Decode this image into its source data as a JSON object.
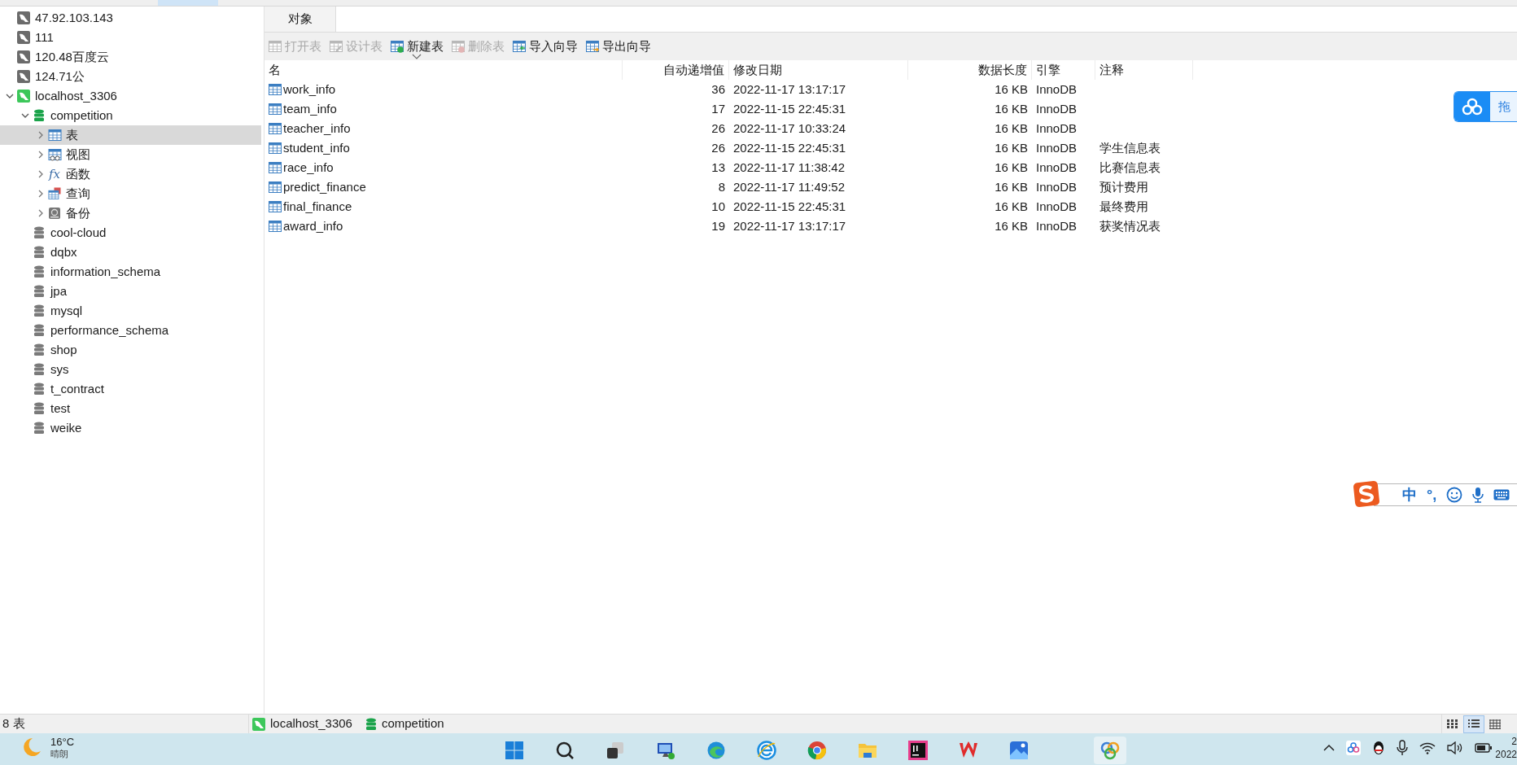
{
  "sidebar": {
    "tree": [
      {
        "kind": "connection",
        "name": "47.92.103.143",
        "connected": false,
        "selected": false
      },
      {
        "kind": "connection",
        "name": "111",
        "connected": false,
        "selected": false
      },
      {
        "kind": "connection",
        "name": "120.48百度云",
        "connected": false,
        "selected": false
      },
      {
        "kind": "connection",
        "name": "124.71公",
        "connected": false,
        "selected": false
      },
      {
        "kind": "connection",
        "name": "localhost_3306",
        "connected": true,
        "expanded": true,
        "selected": false,
        "children": [
          {
            "kind": "database",
            "name": "competition",
            "open": true,
            "expanded": true,
            "selected": false,
            "children": [
              {
                "kind": "tables",
                "name": "表",
                "expanded": false,
                "selected": true
              },
              {
                "kind": "views",
                "name": "视图",
                "expanded": false,
                "selected": false
              },
              {
                "kind": "functions",
                "icon": "fx",
                "name": "函数",
                "expanded": false,
                "selected": false
              },
              {
                "kind": "queries",
                "name": "查询",
                "expanded": false,
                "selected": false
              },
              {
                "kind": "backups",
                "name": "备份",
                "expanded": false,
                "selected": false
              }
            ]
          },
          {
            "kind": "database",
            "name": "cool-cloud",
            "open": false,
            "selected": false
          },
          {
            "kind": "database",
            "name": "dqbx",
            "open": false,
            "selected": false
          },
          {
            "kind": "database",
            "name": "information_schema",
            "open": false,
            "selected": false
          },
          {
            "kind": "database",
            "name": "jpa",
            "open": false,
            "selected": false
          },
          {
            "kind": "database",
            "name": "mysql",
            "open": false,
            "selected": false
          },
          {
            "kind": "database",
            "name": "performance_schema",
            "open": false,
            "selected": false
          },
          {
            "kind": "database",
            "name": "shop",
            "open": false,
            "selected": false
          },
          {
            "kind": "database",
            "name": "sys",
            "open": false,
            "selected": false
          },
          {
            "kind": "database",
            "name": "t_contract",
            "open": false,
            "selected": false
          },
          {
            "kind": "database",
            "name": "test",
            "open": false,
            "selected": false
          },
          {
            "kind": "database",
            "name": "weike",
            "open": false,
            "selected": false
          }
        ]
      }
    ]
  },
  "tabs": [
    {
      "label": "对象",
      "selected": true
    }
  ],
  "toolbar": [
    {
      "kind": "open",
      "label": "打开表",
      "disabled": true
    },
    {
      "kind": "design",
      "label": "设计表",
      "disabled": true
    },
    {
      "kind": "new",
      "label": "新建表",
      "disabled": false
    },
    {
      "kind": "delete",
      "label": "删除表",
      "disabled": true
    },
    {
      "kind": "import",
      "label": "导入向导",
      "disabled": false
    },
    {
      "kind": "export",
      "label": "导出向导",
      "disabled": false
    }
  ],
  "table": {
    "columns": [
      {
        "label": "名"
      },
      {
        "label": "自动递增值"
      },
      {
        "label": "修改日期"
      },
      {
        "label": "数据长度"
      },
      {
        "label": "引擎"
      },
      {
        "label": "注释"
      }
    ],
    "rows": [
      [
        "work_info",
        "36",
        "2022-11-17 13:17:17",
        "16 KB",
        "InnoDB",
        ""
      ],
      [
        "team_info",
        "17",
        "2022-11-15 22:45:31",
        "16 KB",
        "InnoDB",
        ""
      ],
      [
        "teacher_info",
        "26",
        "2022-11-17 10:33:24",
        "16 KB",
        "InnoDB",
        ""
      ],
      [
        "student_info",
        "26",
        "2022-11-15 22:45:31",
        "16 KB",
        "InnoDB",
        "学生信息表"
      ],
      [
        "race_info",
        "13",
        "2022-11-17 11:38:42",
        "16 KB",
        "InnoDB",
        "比赛信息表"
      ],
      [
        "predict_finance",
        "8",
        "2022-11-17 11:49:52",
        "16 KB",
        "InnoDB",
        "预计费用"
      ],
      [
        "final_finance",
        "10",
        "2022-11-15 22:45:31",
        "16 KB",
        "InnoDB",
        "最终费用"
      ],
      [
        "award_info",
        "19",
        "2022-11-17 13:17:17",
        "16 KB",
        "InnoDB",
        "获奖情况表"
      ]
    ]
  },
  "status_bar": {
    "count": "8 表",
    "connection": "localhost_3306",
    "database": "competition",
    "views": [
      {
        "kind": "icons",
        "selected": false
      },
      {
        "kind": "list",
        "selected": true
      },
      {
        "kind": "grid",
        "selected": false
      }
    ]
  },
  "cloud_widget": {
    "label": "拖"
  },
  "ime_bar": {
    "mode": "中",
    "punctuation": "°,"
  },
  "taskbar": {
    "weather": {
      "temp": "16°C",
      "condition": "晴朗"
    },
    "apps": [
      {
        "kind": "start",
        "active": false
      },
      {
        "kind": "search",
        "active": false
      },
      {
        "kind": "taskview",
        "active": false
      },
      {
        "kind": "remote",
        "active": false
      },
      {
        "kind": "edge",
        "active": false
      },
      {
        "kind": "ie",
        "active": false
      },
      {
        "kind": "chrome",
        "active": false
      },
      {
        "kind": "folder",
        "active": false
      },
      {
        "kind": "ide",
        "active": false
      },
      {
        "kind": "wps",
        "active": false
      },
      {
        "kind": "photos",
        "active": false
      },
      {
        "kind": "navicat",
        "active": true
      }
    ],
    "clock": {
      "time": "2",
      "date": "2022"
    }
  }
}
